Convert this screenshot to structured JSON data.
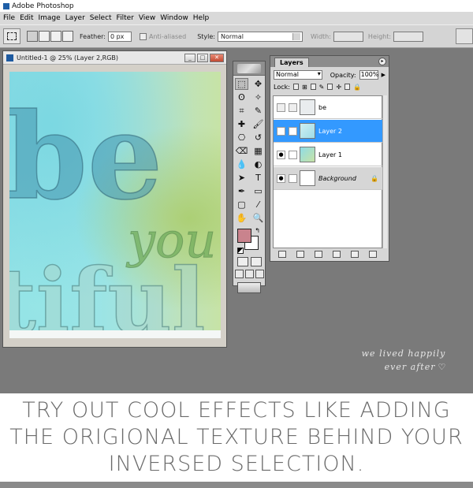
{
  "app": {
    "title": "Adobe Photoshop"
  },
  "menu": [
    "File",
    "Edit",
    "Image",
    "Layer",
    "Select",
    "Filter",
    "View",
    "Window",
    "Help"
  ],
  "options": {
    "feather_label": "Feather:",
    "feather_value": "0 px",
    "antialiased_label": "Anti-aliased",
    "style_label": "Style:",
    "style_value": "Normal",
    "width_label": "Width:",
    "height_label": "Height:"
  },
  "document": {
    "title": "Untitled-1 @ 25% (Layer 2,RGB)",
    "art_words": [
      "be",
      "you",
      "tiful"
    ]
  },
  "tools": {
    "icons": [
      "marquee-icon",
      "move-icon",
      "lasso-icon",
      "magic-wand-icon",
      "crop-icon",
      "slice-icon",
      "healing-icon",
      "brush-icon",
      "stamp-icon",
      "history-brush-icon",
      "eraser-icon",
      "gradient-icon",
      "blur-icon",
      "dodge-icon",
      "path-select-icon",
      "type-icon",
      "pen-icon",
      "shape-icon",
      "notes-icon",
      "eyedropper-icon",
      "hand-icon",
      "zoom-icon"
    ],
    "glyphs": [
      "⬚",
      "✥",
      "ʘ",
      "✧",
      "⌗",
      "✎",
      "✚",
      "🖌",
      "⎔",
      "↺",
      "⌫",
      "▦",
      "💧",
      "◐",
      "➤",
      "T",
      "✒",
      "▭",
      "▢",
      "⁄",
      "✋",
      "🔍"
    ],
    "foreground_color": "#c9838d",
    "background_color": "#ffffff"
  },
  "layers": {
    "tab": "Layers",
    "blend_mode": "Normal",
    "opacity_label": "Opacity:",
    "opacity_value": "100%",
    "lock_label": "Lock:",
    "rows": [
      {
        "name": "be",
        "visible": false,
        "selected": false
      },
      {
        "name": "Layer 2",
        "visible": true,
        "selected": true
      },
      {
        "name": "Layer 1",
        "visible": true,
        "selected": false
      },
      {
        "name": "Background",
        "visible": true,
        "selected": false,
        "locked": true
      }
    ]
  },
  "watermark": {
    "line1": "we lived happily",
    "line2": "ever after"
  },
  "caption": {
    "line1": "TRY OUT COOL EFFECTS LIKE ADDING",
    "line2": "THE ORIGIONAL TEXTURE BEHIND YOUR",
    "line3": "INVERSED SELECTION."
  },
  "colors": {
    "selection_blue": "#3399ff",
    "workspace_gray": "#7a7a7a"
  }
}
